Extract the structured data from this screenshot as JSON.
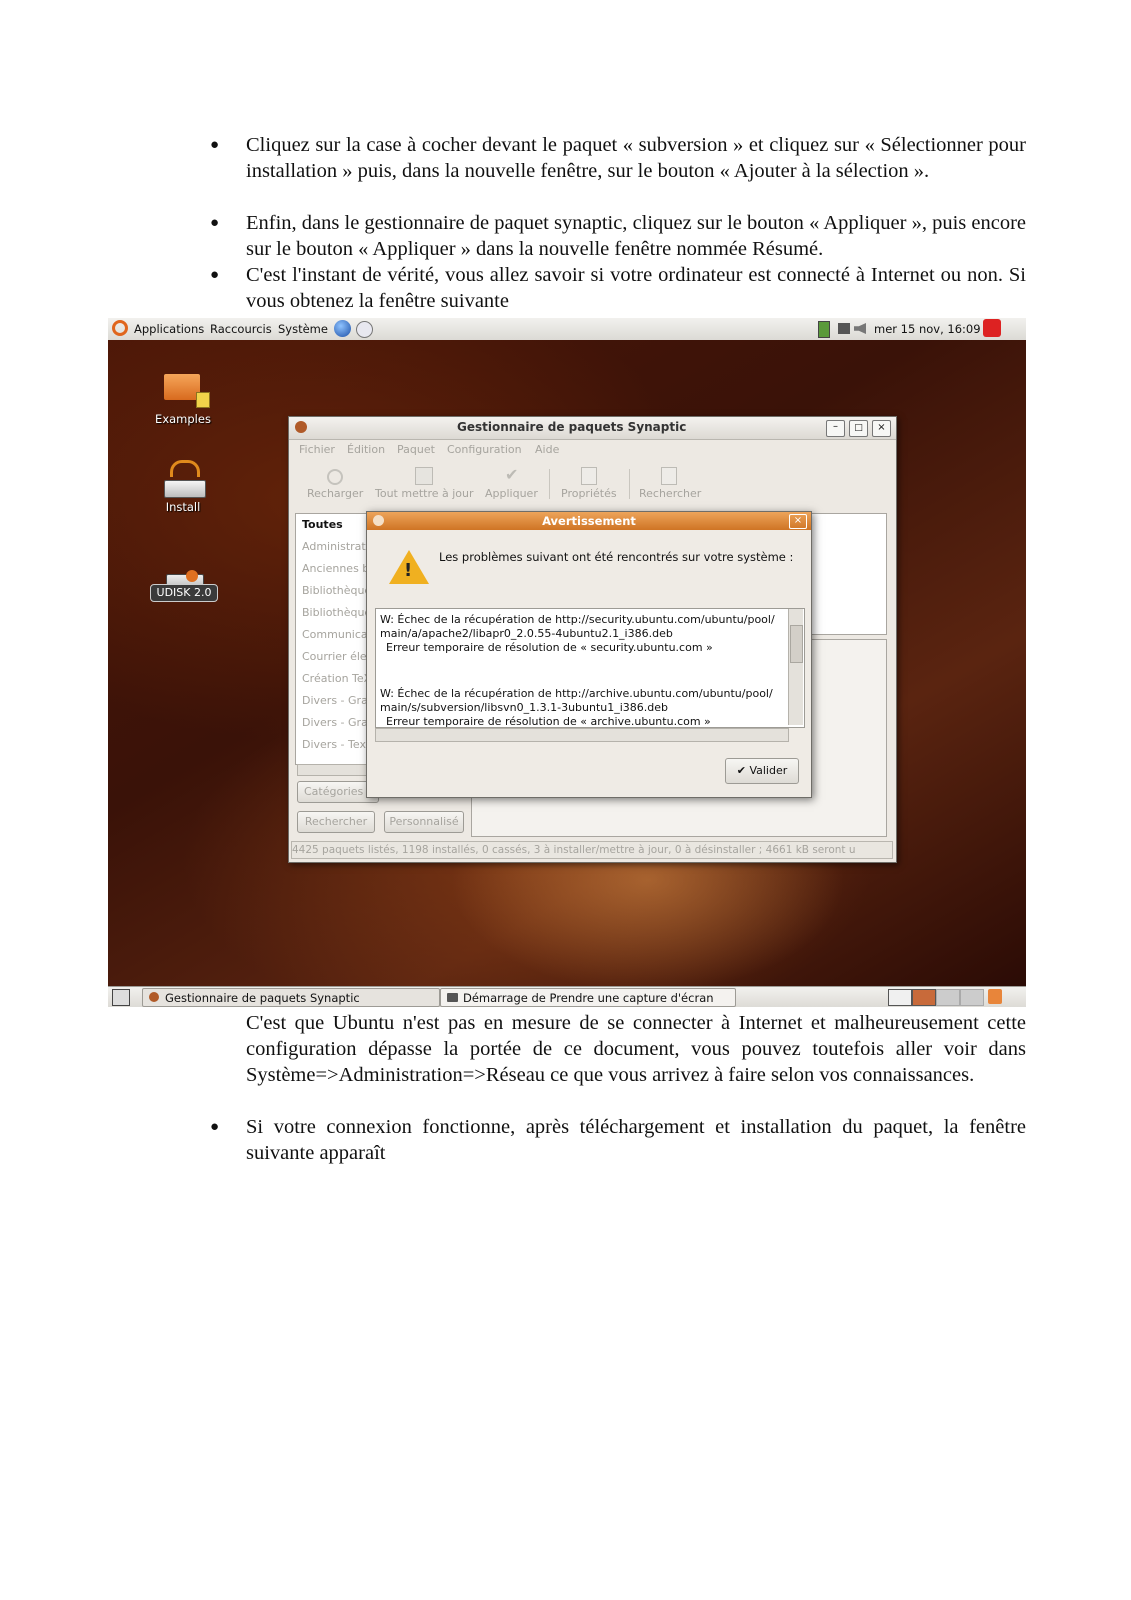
{
  "intro": {
    "bullet1": "Cliquez sur la case à cocher devant le paquet « subversion » et cliquez sur « Sélectionner pour installation » puis, dans la nouvelle fenêtre, sur le bouton « Ajouter à la sélection ».",
    "bullet2": "Enfin, dans le gestionnaire de paquet synaptic, cliquez sur le bouton « Appliquer », puis encore sur le bouton « Appliquer » dans la nouvelle fenêtre nommée Résumé.",
    "bullet3": "C'est l'instant de vérité, vous allez savoir si votre ordinateur est connecté à Internet ou non. Si vous obtenez la fenêtre suivante",
    "bullet_char": "●"
  },
  "screenshot": {
    "topbar": {
      "menus": [
        "Applications",
        "Raccourcis",
        "Système"
      ],
      "clock": "mer 15 nov, 16:09"
    },
    "desktop_icons": {
      "examples": "Examples",
      "install": "Install",
      "udisk": "UDISK 2.0"
    },
    "synaptic": {
      "title": "Gestionnaire de paquets Synaptic",
      "menu": [
        "Fichier",
        "Édition",
        "Paquet",
        "Configuration",
        "Aide"
      ],
      "toolbar": [
        "Recharger",
        "Tout mettre à jour",
        "Appliquer",
        "Propriétés",
        "Rechercher"
      ],
      "sidebar_header": "Toutes",
      "sidebar_items": [
        "Administratio",
        "Anciennes b",
        "Bibliothèque",
        "Bibliothèque",
        "Communicat",
        "Courrier élec",
        "Création TeX",
        "Divers - Grap",
        "Divers - Grap",
        "Divers - Texte"
      ],
      "categories_button": "Catégories",
      "search_button": "Rechercher",
      "custom_button": "Personnalisé",
      "status": "4425 paquets listés, 1198 installés, 0 cassés, 3 à installer/mettre à jour, 0 à désinstaller ; 4661 kB seront u"
    },
    "dialog": {
      "title": "Avertissement",
      "message": "Les problèmes suivant ont été rencontrés sur votre système :",
      "lines": [
        "W: Échec de la récupération de http://security.ubuntu.com/ubuntu/pool/",
        "main/a/apache2/libapr0_2.0.55-4ubuntu2.1_i386.deb",
        "  Erreur temporaire de résolution de « security.ubuntu.com »",
        "",
        "W: Échec de la récupération de http://archive.ubuntu.com/ubuntu/pool/",
        "main/s/subversion/libsvn0_1.3.1-3ubuntu1_i386.deb",
        "  Erreur temporaire de résolution de « archive.ubuntu.com »"
      ],
      "ok_button": "Valider"
    },
    "taskbar": {
      "item1": "Gestionnaire de paquets Synaptic",
      "item2": "Démarrage de Prendre une capture d'écran"
    }
  },
  "outro": {
    "para1": "C'est que Ubuntu n'est pas en mesure de se connecter à Internet et malheureusement cette configuration dépasse la portée de ce document, vous pouvez toutefois aller voir dans Système=>Administration=>Réseau ce que vous arrivez à faire selon vos connaissances.",
    "bullet4": "Si votre connexion fonctionne, après téléchargement et installation du paquet, la fenêtre suivante apparaît"
  },
  "colors": {
    "dialog_title": "#d9802e",
    "desktop": "#3a1208"
  }
}
